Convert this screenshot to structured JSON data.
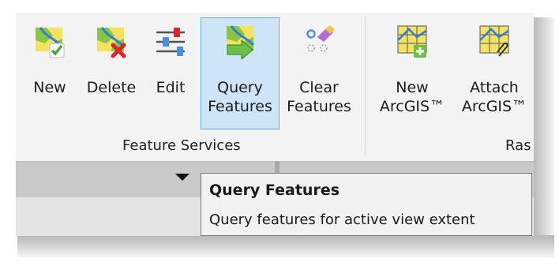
{
  "ribbon": {
    "buttons": {
      "new": {
        "label": "New",
        "icon": "map-new-icon"
      },
      "delete": {
        "label": "Delete",
        "icon": "map-delete-icon"
      },
      "edit": {
        "label": "Edit",
        "icon": "sliders-edit-icon"
      },
      "query": {
        "label": "Query\nFeatures",
        "icon": "map-query-arrow-icon"
      },
      "clear": {
        "label": "Clear\nFeatures",
        "icon": "clear-features-icon"
      },
      "new_arcgis": {
        "label": "New\nArcGIS™",
        "icon": "raster-new-icon"
      },
      "attach_arcgis": {
        "label": "Attach\nArcGIS™",
        "icon": "raster-attach-icon"
      }
    },
    "groups": {
      "feature_services": "Feature Services",
      "raster_partial": "Ras"
    }
  },
  "tooltip": {
    "title": "Query Features",
    "description": "Query features for active view extent"
  },
  "colors": {
    "active_bg": "#cde5f7",
    "active_border": "#6fa8d8",
    "map_green": "#8cc641",
    "map_yellow": "#f5e35f",
    "map_road_blue": "#2f7fd8",
    "delete_red": "#d9262b",
    "arrow_green": "#6cc04a"
  }
}
